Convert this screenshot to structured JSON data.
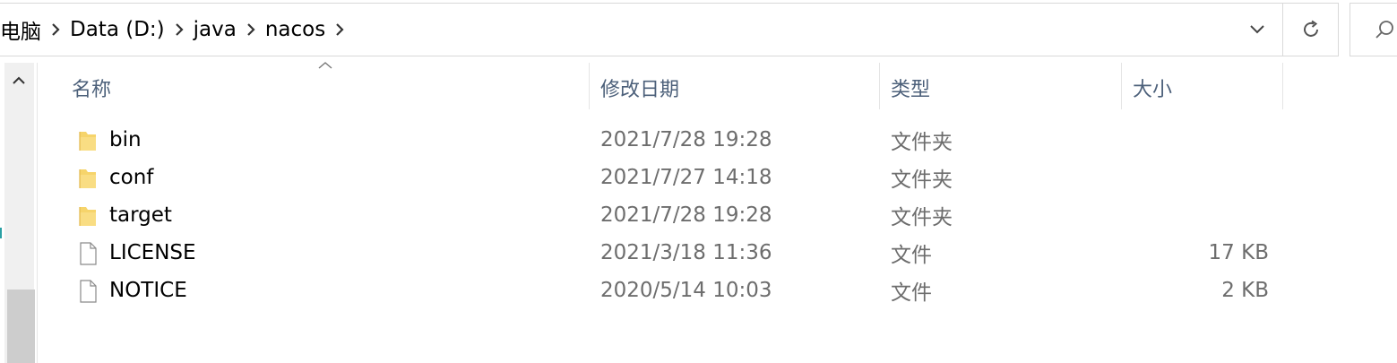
{
  "address": {
    "breadcrumbs": [
      "电脑",
      "Data (D:)",
      "java",
      "nacos"
    ]
  },
  "columns": {
    "name": "名称",
    "date": "修改日期",
    "type": "类型",
    "size": "大小"
  },
  "files": [
    {
      "name": "bin",
      "date": "2021/7/28 19:28",
      "type": "文件夹",
      "size": "",
      "icon": "folder-icon"
    },
    {
      "name": "conf",
      "date": "2021/7/27 14:18",
      "type": "文件夹",
      "size": "",
      "icon": "folder-icon"
    },
    {
      "name": "target",
      "date": "2021/7/28 19:28",
      "type": "文件夹",
      "size": "",
      "icon": "folder-icon"
    },
    {
      "name": "LICENSE",
      "date": "2021/3/18 11:36",
      "type": "文件",
      "size": "17 KB",
      "icon": "file-icon"
    },
    {
      "name": "NOTICE",
      "date": "2020/5/14 10:03",
      "type": "文件",
      "size": "2 KB",
      "icon": "file-icon"
    }
  ],
  "colors": {
    "folder": "#f6d46b",
    "header_text": "#4c607a",
    "secondary_text": "#6d6d6d"
  }
}
